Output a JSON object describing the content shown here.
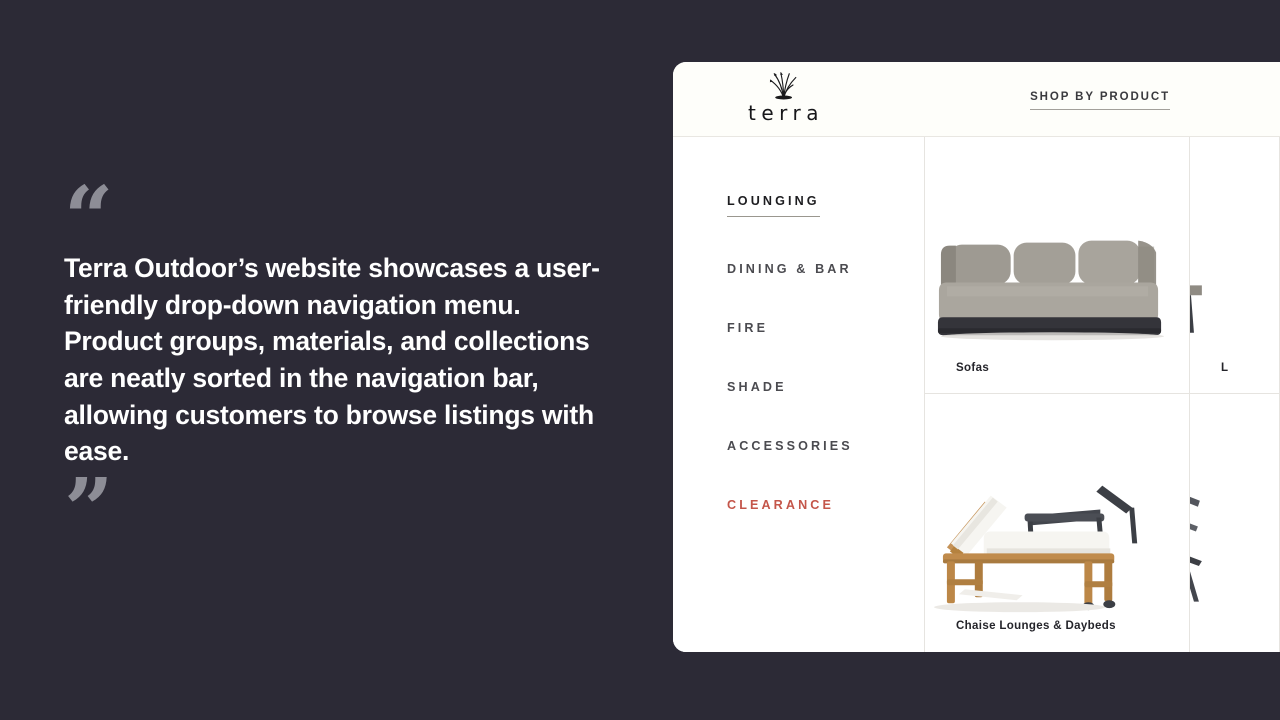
{
  "theme": {
    "background": "#2c2a36",
    "panel_background": "#ffffff",
    "header_background": "#fefefa",
    "quote_mark_color": "#8d8d96",
    "quote_text_color": "#ffffff",
    "accent_sale": "#c4564a",
    "divider": "#e6e4e0"
  },
  "quote": {
    "open_mark": "“",
    "close_mark": "”",
    "text": "Terra Outdoor’s website showcases a user-friendly drop-down navigation menu. Product groups, materials, and collections are neatly sorted in the navigation bar, allowing customers to browse listings with ease."
  },
  "site": {
    "header": {
      "logo_word": "terra",
      "logo_icon": "grass-tuft-icon",
      "nav_link": "SHOP BY PRODUCT"
    },
    "dropdown": {
      "categories": [
        {
          "label": "LOUNGING",
          "state": "active"
        },
        {
          "label": "DINING & BAR",
          "state": "default"
        },
        {
          "label": "FIRE",
          "state": "default"
        },
        {
          "label": "SHADE",
          "state": "default"
        },
        {
          "label": "ACCESSORIES",
          "state": "default"
        },
        {
          "label": "CLEARANCE",
          "state": "sale"
        }
      ],
      "product_cards": [
        {
          "label": "Sofas",
          "art": "grey-sofa"
        },
        {
          "label": "Chaise Lounges & Daybeds",
          "art": "teak-chaise-lounge"
        }
      ],
      "partial_cards": [
        {
          "label": "L",
          "art": "cut-off-product-top"
        },
        {
          "label": "",
          "art": "cut-off-product-bottom"
        }
      ]
    }
  }
}
